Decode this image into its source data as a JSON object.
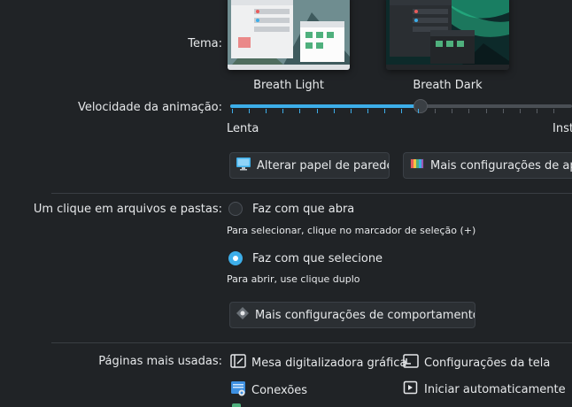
{
  "theme": {
    "label": "Tema:",
    "options": [
      {
        "name": "Breath Light",
        "selected": false
      },
      {
        "name": "Breath Dark",
        "selected": true
      }
    ]
  },
  "animation": {
    "label": "Velocidade da animação:",
    "min_label": "Lenta",
    "max_label": "Inst",
    "value_fraction": 0.5
  },
  "buttons": {
    "wallpaper": "Alterar papel de parede...",
    "appearance": "Mais configurações de apar"
  },
  "click_behavior": {
    "label": "Um clique em arquivos e pastas:",
    "open_option": "Faz com que abra",
    "open_hint": "Para selecionar, clique no marcador de seleção (+)",
    "select_option": "Faz com que selecione",
    "select_hint": "Para abrir, use clique duplo",
    "selected": "select",
    "more_button": "Mais configurações de comportamento..."
  },
  "most_used": {
    "label": "Páginas mais usadas:",
    "pages": [
      {
        "label": "Mesa digitalizadora gráfica",
        "icon": "tablet-icon"
      },
      {
        "label": "Configurações da tela",
        "icon": "display-icon"
      },
      {
        "label": "Conexões",
        "icon": "network-icon"
      },
      {
        "label": "Iniciar automaticamente",
        "icon": "autostart-icon"
      }
    ]
  },
  "colors": {
    "accent": "#3daee9",
    "background": "#202326",
    "button": "#2b2f33"
  }
}
